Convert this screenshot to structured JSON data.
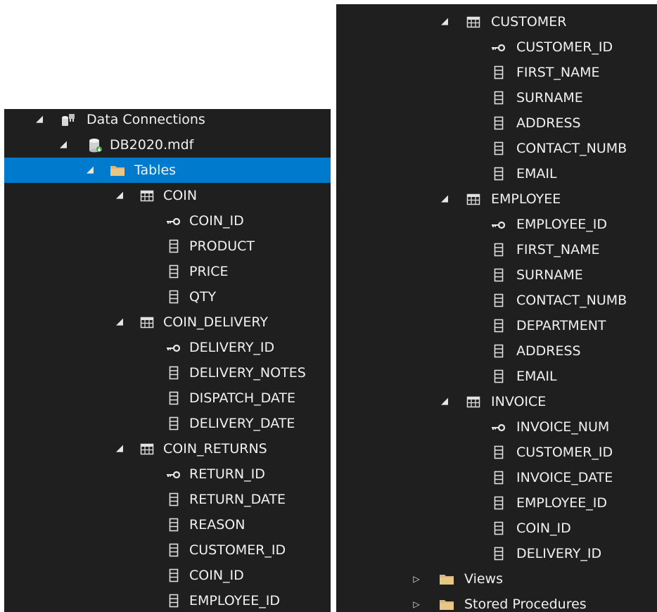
{
  "left_tree": [
    {
      "label": "Data Connections",
      "type": "connections",
      "level": 0,
      "expanded": true
    },
    {
      "label": "DB2020.mdf",
      "type": "database",
      "level": 1,
      "expanded": true
    },
    {
      "label": "Tables",
      "type": "folder",
      "level": 2,
      "expanded": true,
      "selected": true
    },
    {
      "label": "COIN",
      "type": "table",
      "level": 3,
      "expanded": true
    },
    {
      "label": "COIN_ID",
      "type": "key",
      "level": 4
    },
    {
      "label": "PRODUCT",
      "type": "column",
      "level": 4
    },
    {
      "label": "PRICE",
      "type": "column",
      "level": 4
    },
    {
      "label": "QTY",
      "type": "column",
      "level": 4
    },
    {
      "label": "COIN_DELIVERY",
      "type": "table",
      "level": 3,
      "expanded": true
    },
    {
      "label": "DELIVERY_ID",
      "type": "key",
      "level": 4
    },
    {
      "label": "DELIVERY_NOTES",
      "type": "column",
      "level": 4
    },
    {
      "label": "DISPATCH_DATE",
      "type": "column",
      "level": 4
    },
    {
      "label": "DELIVERY_DATE",
      "type": "column",
      "level": 4
    },
    {
      "label": "COIN_RETURNS",
      "type": "table",
      "level": 3,
      "expanded": true
    },
    {
      "label": "RETURN_ID",
      "type": "key",
      "level": 4
    },
    {
      "label": "RETURN_DATE",
      "type": "column",
      "level": 4
    },
    {
      "label": "REASON",
      "type": "column",
      "level": 4
    },
    {
      "label": "CUSTOMER_ID",
      "type": "column",
      "level": 4
    },
    {
      "label": "COIN_ID",
      "type": "column",
      "level": 4
    },
    {
      "label": "EMPLOYEE_ID",
      "type": "column",
      "level": 4
    }
  ],
  "right_tree": [
    {
      "label": "CUSTOMER",
      "type": "table",
      "level": 3,
      "expanded": true
    },
    {
      "label": "CUSTOMER_ID",
      "type": "key",
      "level": 4
    },
    {
      "label": "FIRST_NAME",
      "type": "column",
      "level": 4
    },
    {
      "label": "SURNAME",
      "type": "column",
      "level": 4
    },
    {
      "label": "ADDRESS",
      "type": "column",
      "level": 4
    },
    {
      "label": "CONTACT_NUMB",
      "type": "column",
      "level": 4
    },
    {
      "label": "EMAIL",
      "type": "column",
      "level": 4
    },
    {
      "label": "EMPLOYEE",
      "type": "table",
      "level": 3,
      "expanded": true
    },
    {
      "label": "EMPLOYEE_ID",
      "type": "key",
      "level": 4
    },
    {
      "label": "FIRST_NAME",
      "type": "column",
      "level": 4
    },
    {
      "label": "SURNAME",
      "type": "column",
      "level": 4
    },
    {
      "label": "CONTACT_NUMB",
      "type": "column",
      "level": 4
    },
    {
      "label": "DEPARTMENT",
      "type": "column",
      "level": 4
    },
    {
      "label": "ADDRESS",
      "type": "column",
      "level": 4
    },
    {
      "label": "EMAIL",
      "type": "column",
      "level": 4
    },
    {
      "label": "INVOICE",
      "type": "table",
      "level": 3,
      "expanded": true
    },
    {
      "label": "INVOICE_NUM",
      "type": "key",
      "level": 4
    },
    {
      "label": "CUSTOMER_ID",
      "type": "column",
      "level": 4
    },
    {
      "label": "INVOICE_DATE",
      "type": "column",
      "level": 4
    },
    {
      "label": "EMPLOYEE_ID",
      "type": "column",
      "level": 4
    },
    {
      "label": "COIN_ID",
      "type": "column",
      "level": 4
    },
    {
      "label": "DELIVERY_ID",
      "type": "column",
      "level": 4
    },
    {
      "label": "Views",
      "type": "folder",
      "level": 2,
      "expanded": false
    },
    {
      "label": "Stored Procedures",
      "type": "folder",
      "level": 2,
      "expanded": false
    }
  ],
  "icons": {
    "connections": "data-connections-icon",
    "database": "database-icon",
    "folder": "folder-icon",
    "table": "table-icon",
    "key": "key-icon",
    "column": "column-icon"
  },
  "colors": {
    "background": "#1f1f1f",
    "text": "#f1f1f1",
    "selection": "#007acc",
    "folder": "#dcb67a"
  }
}
